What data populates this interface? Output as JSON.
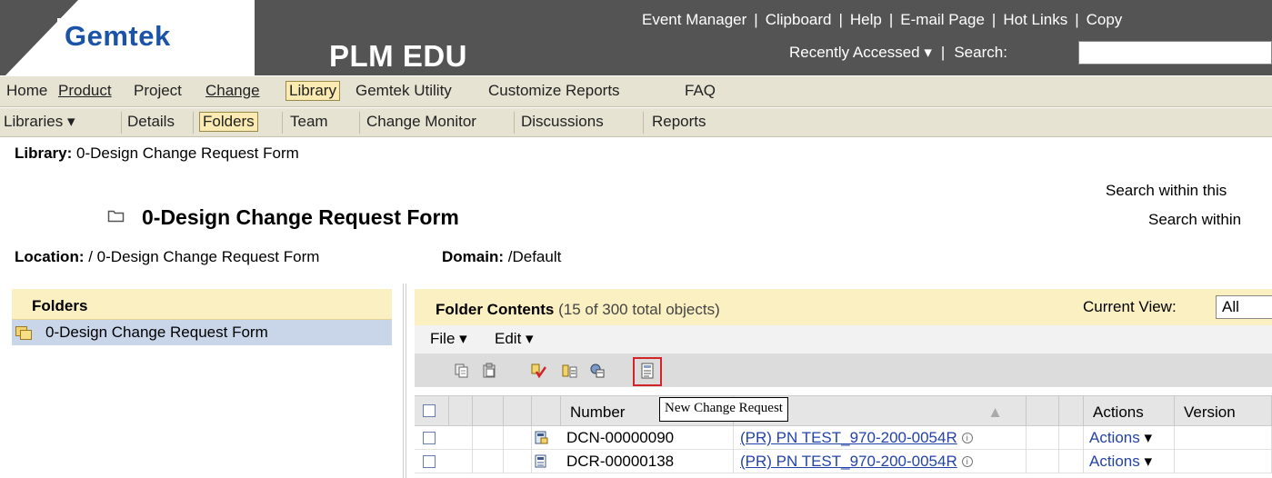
{
  "header": {
    "logo_text": "Gemtek",
    "app_title": "PLM EDU",
    "top_links": [
      "Event Manager",
      "Clipboard",
      "Help",
      "E-mail Page",
      "Hot Links",
      "Copy"
    ],
    "recently_accessed": "Recently Accessed",
    "search_label": "Search:",
    "search_value": ""
  },
  "nav": {
    "main": [
      "Home",
      "Product",
      "Project",
      "Change",
      "Library",
      "Gemtek Utility",
      "Customize Reports",
      "FAQ"
    ],
    "sub": [
      "Libraries",
      "Details",
      "Folders",
      "Team",
      "Change Monitor",
      "Discussions",
      "Reports"
    ],
    "main_active": "Library",
    "sub_active": "Folders"
  },
  "context": {
    "library_label": "Library:",
    "library_value": "0-Design Change Request Form",
    "search_within_1": "Search within this",
    "search_within_2": "Search within",
    "folder_title": "0-Design Change Request Form",
    "location_label": "Location:",
    "location_value": "/ 0-Design Change Request Form",
    "domain_label": "Domain:",
    "domain_value": "/Default"
  },
  "left_panel": {
    "header": "Folders",
    "items": [
      "0-Design Change Request Form"
    ]
  },
  "right_panel": {
    "header_title": "Folder Contents",
    "header_count": "(15 of 300 total objects)",
    "current_view_label": "Current View:",
    "current_view_value": "All",
    "menu": [
      "File",
      "Edit"
    ],
    "toolbar_icons": [
      "copy-icon",
      "paste-icon",
      "checkout-icon",
      "move-icon",
      "new-document-icon",
      "new-change-request-icon"
    ],
    "tooltip": "New Change Request",
    "columns": [
      "Number",
      "Actions",
      "Version"
    ],
    "rows": [
      {
        "number": "DCN-00000090",
        "name": "(PR) PN TEST_970-200-0054R",
        "actions": "Actions"
      },
      {
        "number": "DCR-00000138",
        "name": "(PR) PN TEST_970-200-0054R",
        "actions": "Actions"
      }
    ]
  },
  "colors": {
    "header_bg": "#545454",
    "nav_bg": "#e6e3d3",
    "panel_head_bg": "#fbf0c2",
    "selected_row_bg": "#c9d6ea",
    "link": "#2443a9",
    "highlight_border": "#d3242a"
  }
}
